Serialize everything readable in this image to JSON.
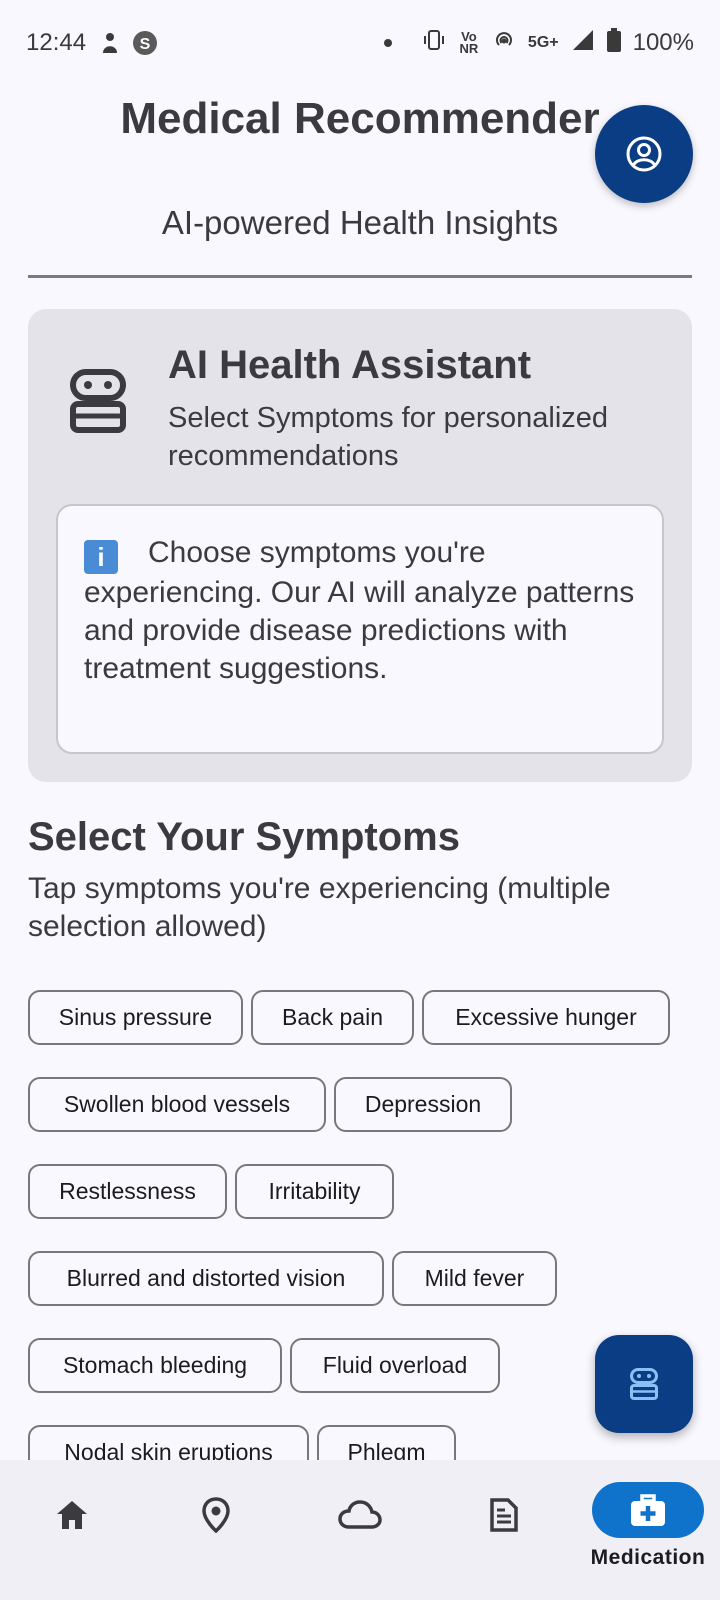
{
  "status_bar": {
    "time": "12:44",
    "net_small": "Vo NR",
    "net_type": "5G+",
    "battery": "100%"
  },
  "header": {
    "title": "Medical Recommender",
    "subtitle": "AI-powered Health Insights"
  },
  "assistant": {
    "title": "AI Health Assistant",
    "subtitle": "Select Symptoms for personalized recommendations",
    "info_glyph": "i",
    "info_text": "Choose symptoms you're experiencing. Our AI will analyze patterns and provide disease predictions with treatment suggestions."
  },
  "symptoms": {
    "title": "Select Your Symptoms",
    "subtitle": "Tap symptoms you're experiencing (multiple selection allowed)",
    "rows": [
      [
        "Sinus pressure",
        "Back pain",
        "Excessive hunger"
      ],
      [
        "Swollen blood vessels",
        "Depression"
      ],
      [
        "Restlessness",
        "Irritability"
      ],
      [
        "Blurred and distorted vision",
        "Mild fever"
      ],
      [
        "Stomach bleeding",
        "Fluid overload"
      ],
      [
        "Nodal skin eruptions",
        "Phlegm"
      ]
    ]
  },
  "bottom_nav": {
    "items": [
      {
        "icon": "home-icon",
        "label": ""
      },
      {
        "icon": "location-icon",
        "label": ""
      },
      {
        "icon": "cloud-icon",
        "label": ""
      },
      {
        "icon": "document-icon",
        "label": ""
      },
      {
        "icon": "medical-kit-icon",
        "label": "Medication",
        "active": true
      }
    ]
  },
  "colors": {
    "primary": "#0a3d84",
    "nav_active": "#0f72cb",
    "card_bg": "#e3e3e9",
    "page_bg": "#f8f8fe"
  }
}
